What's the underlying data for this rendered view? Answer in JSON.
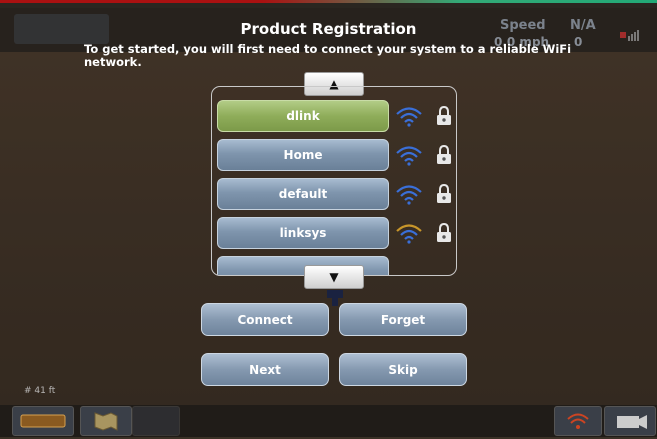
{
  "dialog": {
    "title": "Product Registration",
    "instruction": "To get started, you will first need to connect your system to a reliable WiFi network."
  },
  "status": {
    "speed_label": "Speed",
    "speed_value": "0.0 mph",
    "na_label": "N/A",
    "na_value": "0"
  },
  "networks": [
    {
      "name": "dlink",
      "selected": true,
      "signal": "strong",
      "locked": true
    },
    {
      "name": "Home",
      "selected": false,
      "signal": "strong",
      "locked": true
    },
    {
      "name": "default",
      "selected": false,
      "signal": "strong",
      "locked": true
    },
    {
      "name": "linksys",
      "selected": false,
      "signal": "medium",
      "locked": true
    }
  ],
  "scroll": {
    "up_icon": "▲",
    "down_icon": "▼"
  },
  "buttons": {
    "connect": "Connect",
    "forget": "Forget",
    "next": "Next",
    "skip": "Skip"
  },
  "map": {
    "scale": "41 ft"
  },
  "colors": {
    "selected": "#8fad5a",
    "button": "#8599b0",
    "wifi_strong": "#3a6fd8",
    "wifi_medium": "#c8962a"
  },
  "icons": [
    "wifi-icon",
    "lock-icon",
    "up-arrow-icon",
    "down-arrow-icon",
    "camera-icon",
    "map-icon"
  ]
}
